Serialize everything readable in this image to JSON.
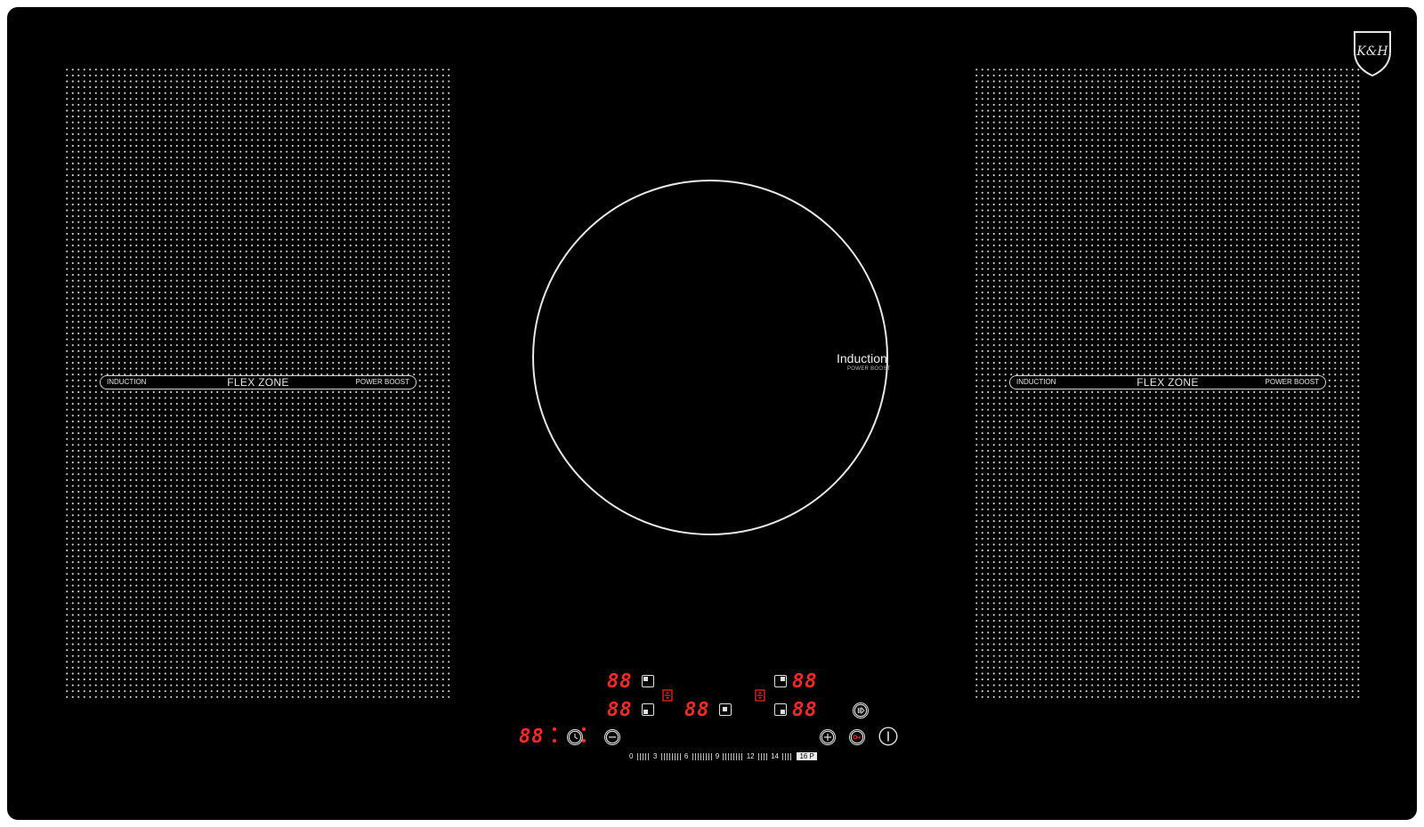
{
  "brand": {
    "logo_text": "K&H"
  },
  "zones": {
    "left": {
      "label_left": "INDUCTION",
      "label_center": "FLEX ZONE",
      "label_right": "POWER BOOST"
    },
    "right": {
      "label_left": "INDUCTION",
      "label_center": "FLEX ZONE",
      "label_right": "POWER BOOST"
    },
    "center": {
      "title": "Induction",
      "subtitle": "POWER BOOST"
    }
  },
  "displays": {
    "front_left": "88",
    "rear_left": "88",
    "center": "88",
    "front_right": "88",
    "rear_right": "88",
    "timer": "88"
  },
  "scale": {
    "labels": [
      "0",
      "3",
      "6",
      "9",
      "12",
      "14"
    ],
    "boost": "16 P"
  },
  "colors": {
    "display": "#ff2a2a",
    "glass": "#000000",
    "print": "#e0e0e0"
  }
}
